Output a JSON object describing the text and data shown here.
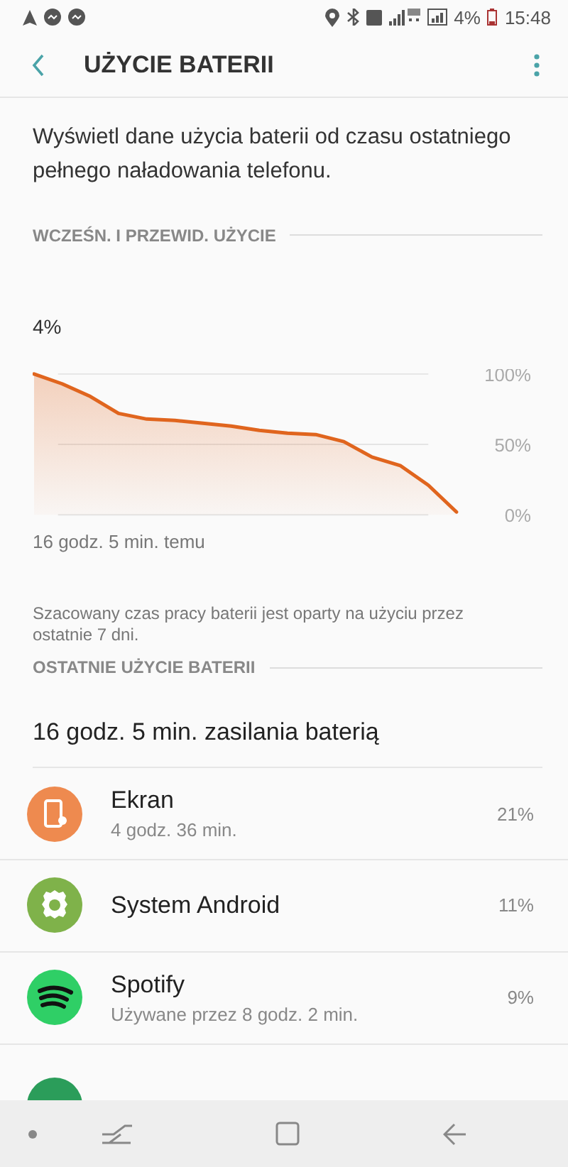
{
  "status_bar": {
    "battery": "4%",
    "time": "15:48"
  },
  "app_bar": {
    "title": "UŻYCIE BATERII"
  },
  "description": "Wyświetl dane użycia baterii od czasu ostatniego pełnego naładowania telefonu.",
  "history": {
    "header": "WCZEŚN. I PRZEWID. UŻYCIE",
    "current": "4%",
    "start_label": "16 godz. 5 min. temu",
    "axis_labels": [
      "100%",
      "50%",
      "0%"
    ],
    "note": "Szacowany czas pracy baterii jest oparty na użyciu przez ostatnie 7 dni."
  },
  "recent": {
    "header": "OSTATNIE UŻYCIE BATERII",
    "summary": "16 godz. 5 min. zasilania baterią",
    "apps": [
      {
        "kind": "screen",
        "color": "#ee8a4f",
        "name": "Ekran",
        "detail": "4 godz. 36 min.",
        "percent": "21%"
      },
      {
        "kind": "system",
        "color": "#7fb24a",
        "name": "System Android",
        "percent": "11%"
      },
      {
        "kind": "spotify",
        "color": "#2fcf66",
        "name": "Spotify",
        "detail": "Używane przez 8 godz. 2 min.",
        "percent": "9%"
      }
    ]
  }
}
